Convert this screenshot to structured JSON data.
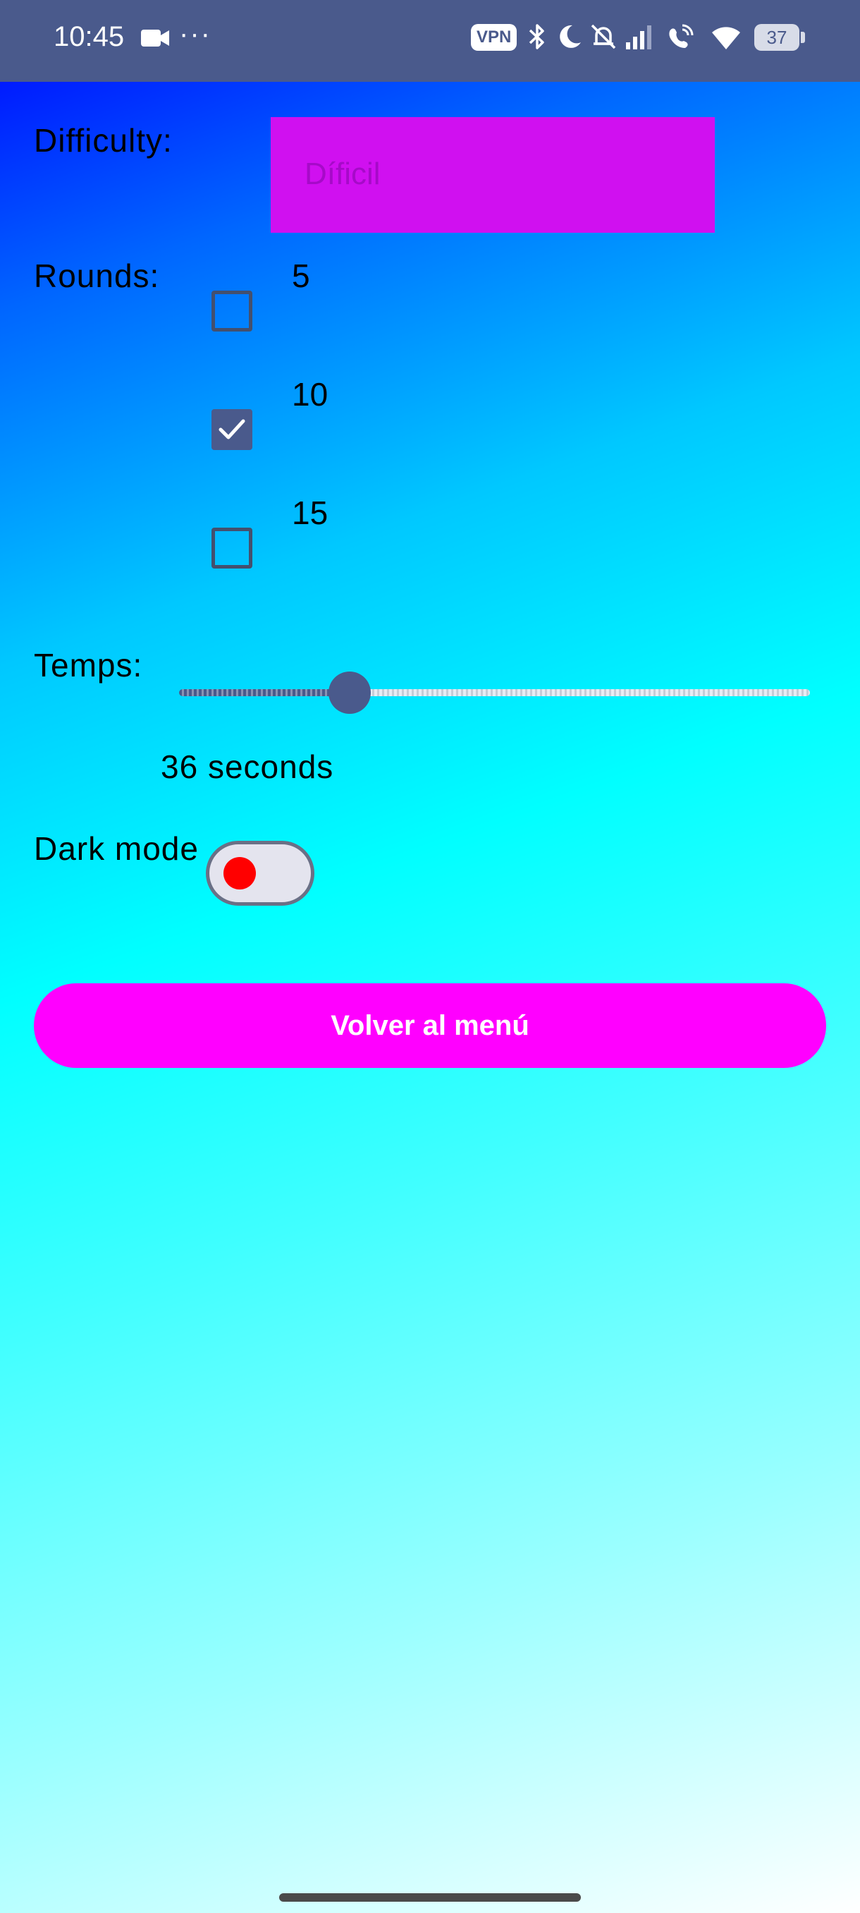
{
  "status_bar": {
    "time": "10:45",
    "dots": "···",
    "vpn": "VPN",
    "battery": "37",
    "icons": [
      "video-camera-icon",
      "bluetooth-icon",
      "moon-icon",
      "bell-off-icon",
      "signal-icon",
      "wifi-calling-icon",
      "wifi-icon",
      "battery-icon"
    ],
    "background": "#4a5a8c"
  },
  "settings": {
    "difficulty_label": "Difficulty:",
    "difficulty_value": "Díficil",
    "rounds_label": "Rounds:",
    "rounds": [
      {
        "label": "5",
        "checked": false
      },
      {
        "label": "10",
        "checked": true
      },
      {
        "label": "15",
        "checked": false
      }
    ],
    "time_label": "Temps:",
    "time_value_text": "36 seconds",
    "time_slider_fraction": 0.27,
    "dark_mode_label": "Dark mode",
    "dark_mode_on": false
  },
  "actions": {
    "back_button": "Volver al menú"
  },
  "colors": {
    "accent": "#4a5a8c",
    "difficulty_box": "#d010f0",
    "button": "#ff00ff",
    "switch_knob": "#ff0000"
  }
}
